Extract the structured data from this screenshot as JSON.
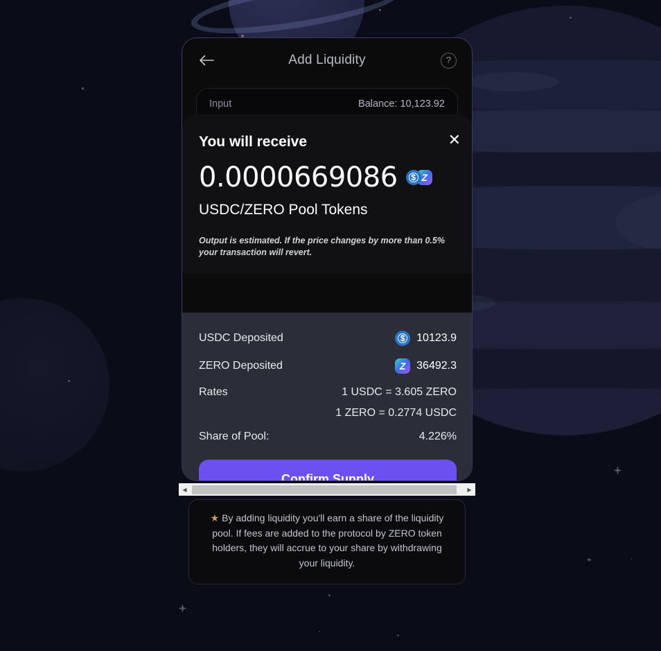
{
  "app": {
    "background_color": "#0a0d18",
    "accent_color": "#6c51f0"
  },
  "modal": {
    "header": {
      "back_icon": "arrow-left-icon",
      "title": "Add Liquidity",
      "help_icon": "question-circle-icon"
    },
    "input_card": {
      "label": "Input",
      "balance": "Balance: 10,123.92"
    }
  },
  "receive_overlay": {
    "heading": "You will receive",
    "close_icon": "close-x-icon",
    "amount": "0.0000669086",
    "tokens": [
      {
        "symbol": "USDC",
        "icon": "usdc-token-icon",
        "glyph": "$",
        "color": "#2775ca"
      },
      {
        "symbol": "ZERO",
        "icon": "zero-token-icon",
        "glyph": "Z",
        "color": "#a855f7"
      }
    ],
    "pool_tokens_label": "USDC/ZERO Pool Tokens",
    "estimate_note": "Output is estimated. If the price changes by more than 0.5% your transaction will revert."
  },
  "details": {
    "rows": [
      {
        "label": "USDC Deposited",
        "icon": "usdc-token-icon",
        "value": "10123.9"
      },
      {
        "label": "ZERO Deposited",
        "icon": "zero-token-icon",
        "value": "36492.3"
      }
    ],
    "rates": {
      "label": "Rates",
      "values": [
        "1 USDC = 3.605 ZERO",
        "1 ZERO = 0.2774 USDC"
      ]
    },
    "share_of_pool": {
      "label": "Share of Pool:",
      "value": "4.226%"
    },
    "confirm_button": "Confirm Supply"
  },
  "scrollbar": {
    "left_arrow": "◀",
    "right_arrow": "▶"
  },
  "info_card": {
    "star_icon": "star-icon",
    "star_glyph": "★",
    "text": "By adding liquidity you'll earn a share of the liquidity pool. If fees are added to the protocol by ZERO token holders, they will accrue to your share by withdrawing your liquidity."
  }
}
